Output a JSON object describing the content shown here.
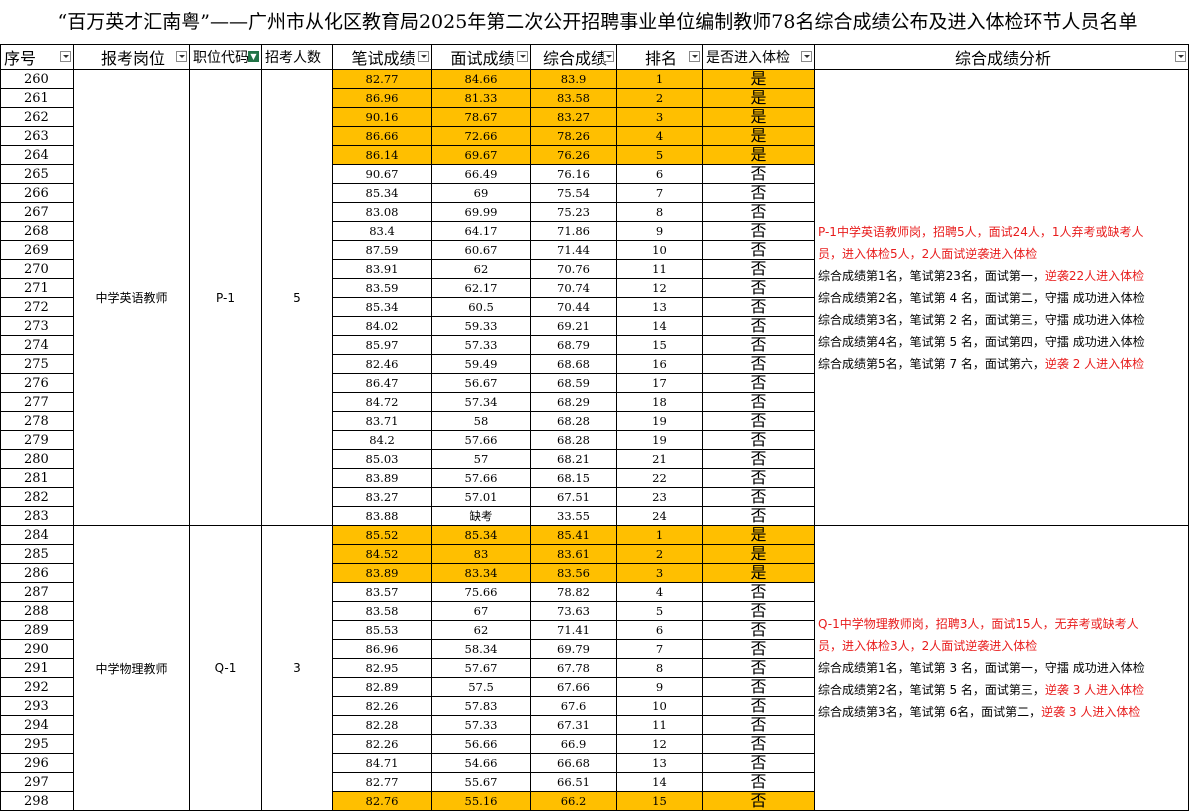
{
  "title": "“百万英才汇南粤”——广州市从化区教育局2025年第二次公开招聘事业单位编制教师78名综合成绩公布及进入体检环节人员名单",
  "headers": {
    "seq": "序号",
    "position": "报考岗位",
    "code": "职位代码",
    "quota": "招考人数",
    "written": "笔试成绩",
    "interview": "面试成绩",
    "total": "综合成绩",
    "rank": "排名",
    "exam": "是否进入体检",
    "analysis": "综合成绩分析"
  },
  "colors": {
    "highlight": "#ffbf00",
    "note_red": "#e81c1c"
  },
  "groups": [
    {
      "position": "中学英语教师",
      "code": "P-1",
      "quota": "5",
      "analysis": [
        [
          {
            "t": "P-1中学英语教师岗，招聘5人，面试24人，1人弃考或缺考人",
            "red": true
          }
        ],
        [
          {
            "t": "员，进入体检5人，2人面试逆袭进入体检",
            "red": true
          }
        ],
        [
          {
            "t": "综合成绩第1名，笔试第23名，面试第一，",
            "red": false
          },
          {
            "t": "逆袭22人进入体检",
            "red": true
          }
        ],
        [
          {
            "t": "综合成绩第2名，笔试第 4 名，面试第二，守擂 成功进入体检",
            "red": false
          }
        ],
        [
          {
            "t": "综合成绩第3名，笔试第 2 名，面试第三，守擂 成功进入体检",
            "red": false
          }
        ],
        [
          {
            "t": "综合成绩第4名，笔试第 5 名，面试第四，守擂 成功进入体检",
            "red": false
          }
        ],
        [
          {
            "t": "综合成绩第5名，笔试第 7 名，面试第六，",
            "red": false
          },
          {
            "t": "逆袭 2 人进入体检",
            "red": true
          }
        ]
      ],
      "rows": [
        {
          "seq": "260",
          "written": "82.77",
          "interview": "84.66",
          "total": "83.9",
          "rank": "1",
          "exam": "是",
          "hl": true
        },
        {
          "seq": "261",
          "written": "86.96",
          "interview": "81.33",
          "total": "83.58",
          "rank": "2",
          "exam": "是",
          "hl": true
        },
        {
          "seq": "262",
          "written": "90.16",
          "interview": "78.67",
          "total": "83.27",
          "rank": "3",
          "exam": "是",
          "hl": true
        },
        {
          "seq": "263",
          "written": "86.66",
          "interview": "72.66",
          "total": "78.26",
          "rank": "4",
          "exam": "是",
          "hl": true
        },
        {
          "seq": "264",
          "written": "86.14",
          "interview": "69.67",
          "total": "76.26",
          "rank": "5",
          "exam": "是",
          "hl": true
        },
        {
          "seq": "265",
          "written": "90.67",
          "interview": "66.49",
          "total": "76.16",
          "rank": "6",
          "exam": "否",
          "hl": false
        },
        {
          "seq": "266",
          "written": "85.34",
          "interview": "69",
          "total": "75.54",
          "rank": "7",
          "exam": "否",
          "hl": false
        },
        {
          "seq": "267",
          "written": "83.08",
          "interview": "69.99",
          "total": "75.23",
          "rank": "8",
          "exam": "否",
          "hl": false
        },
        {
          "seq": "268",
          "written": "83.4",
          "interview": "64.17",
          "total": "71.86",
          "rank": "9",
          "exam": "否",
          "hl": false
        },
        {
          "seq": "269",
          "written": "87.59",
          "interview": "60.67",
          "total": "71.44",
          "rank": "10",
          "exam": "否",
          "hl": false
        },
        {
          "seq": "270",
          "written": "83.91",
          "interview": "62",
          "total": "70.76",
          "rank": "11",
          "exam": "否",
          "hl": false
        },
        {
          "seq": "271",
          "written": "83.59",
          "interview": "62.17",
          "total": "70.74",
          "rank": "12",
          "exam": "否",
          "hl": false
        },
        {
          "seq": "272",
          "written": "85.34",
          "interview": "60.5",
          "total": "70.44",
          "rank": "13",
          "exam": "否",
          "hl": false
        },
        {
          "seq": "273",
          "written": "84.02",
          "interview": "59.33",
          "total": "69.21",
          "rank": "14",
          "exam": "否",
          "hl": false
        },
        {
          "seq": "274",
          "written": "85.97",
          "interview": "57.33",
          "total": "68.79",
          "rank": "15",
          "exam": "否",
          "hl": false
        },
        {
          "seq": "275",
          "written": "82.46",
          "interview": "59.49",
          "total": "68.68",
          "rank": "16",
          "exam": "否",
          "hl": false
        },
        {
          "seq": "276",
          "written": "86.47",
          "interview": "56.67",
          "total": "68.59",
          "rank": "17",
          "exam": "否",
          "hl": false
        },
        {
          "seq": "277",
          "written": "84.72",
          "interview": "57.34",
          "total": "68.29",
          "rank": "18",
          "exam": "否",
          "hl": false
        },
        {
          "seq": "278",
          "written": "83.71",
          "interview": "58",
          "total": "68.28",
          "rank": "19",
          "exam": "否",
          "hl": false
        },
        {
          "seq": "279",
          "written": "84.2",
          "interview": "57.66",
          "total": "68.28",
          "rank": "19",
          "exam": "否",
          "hl": false
        },
        {
          "seq": "280",
          "written": "85.03",
          "interview": "57",
          "total": "68.21",
          "rank": "21",
          "exam": "否",
          "hl": false
        },
        {
          "seq": "281",
          "written": "83.89",
          "interview": "57.66",
          "total": "68.15",
          "rank": "22",
          "exam": "否",
          "hl": false
        },
        {
          "seq": "282",
          "written": "83.27",
          "interview": "57.01",
          "total": "67.51",
          "rank": "23",
          "exam": "否",
          "hl": false
        },
        {
          "seq": "283",
          "written": "83.88",
          "interview": "缺考",
          "total": "33.55",
          "rank": "24",
          "exam": "否",
          "hl": false
        }
      ]
    },
    {
      "position": "中学物理教师",
      "code": "Q-1",
      "quota": "3",
      "analysis": [
        [
          {
            "t": "Q-1中学物理教师岗，招聘3人，面试15人，无弃考或缺考人",
            "red": true
          }
        ],
        [
          {
            "t": "员，进入体检3人，2人面试逆袭进入体检",
            "red": true
          }
        ],
        [
          {
            "t": "综合成绩第1名，笔试第 3 名，面试第一，守擂 成功进入体检",
            "red": false
          }
        ],
        [
          {
            "t": "综合成绩第2名，笔试第 5 名，面试第三，",
            "red": false
          },
          {
            "t": "逆袭 3 人进入体检",
            "red": true
          }
        ],
        [
          {
            "t": "综合成绩第3名，笔试第  6名，面试第二，",
            "red": false
          },
          {
            "t": "逆袭 3 人进入体检",
            "red": true
          }
        ]
      ],
      "rows": [
        {
          "seq": "284",
          "written": "85.52",
          "interview": "85.34",
          "total": "85.41",
          "rank": "1",
          "exam": "是",
          "hl": true
        },
        {
          "seq": "285",
          "written": "84.52",
          "interview": "83",
          "total": "83.61",
          "rank": "2",
          "exam": "是",
          "hl": true
        },
        {
          "seq": "286",
          "written": "83.89",
          "interview": "83.34",
          "total": "83.56",
          "rank": "3",
          "exam": "是",
          "hl": true
        },
        {
          "seq": "287",
          "written": "83.57",
          "interview": "75.66",
          "total": "78.82",
          "rank": "4",
          "exam": "否",
          "hl": false
        },
        {
          "seq": "288",
          "written": "83.58",
          "interview": "67",
          "total": "73.63",
          "rank": "5",
          "exam": "否",
          "hl": false
        },
        {
          "seq": "289",
          "written": "85.53",
          "interview": "62",
          "total": "71.41",
          "rank": "6",
          "exam": "否",
          "hl": false
        },
        {
          "seq": "290",
          "written": "86.96",
          "interview": "58.34",
          "total": "69.79",
          "rank": "7",
          "exam": "否",
          "hl": false
        },
        {
          "seq": "291",
          "written": "82.95",
          "interview": "57.67",
          "total": "67.78",
          "rank": "8",
          "exam": "否",
          "hl": false
        },
        {
          "seq": "292",
          "written": "82.89",
          "interview": "57.5",
          "total": "67.66",
          "rank": "9",
          "exam": "否",
          "hl": false
        },
        {
          "seq": "293",
          "written": "82.26",
          "interview": "57.83",
          "total": "67.6",
          "rank": "10",
          "exam": "否",
          "hl": false
        },
        {
          "seq": "294",
          "written": "82.28",
          "interview": "57.33",
          "total": "67.31",
          "rank": "11",
          "exam": "否",
          "hl": false
        },
        {
          "seq": "295",
          "written": "82.26",
          "interview": "56.66",
          "total": "66.9",
          "rank": "12",
          "exam": "否",
          "hl": false
        },
        {
          "seq": "296",
          "written": "84.71",
          "interview": "54.66",
          "total": "66.68",
          "rank": "13",
          "exam": "否",
          "hl": false
        },
        {
          "seq": "297",
          "written": "82.77",
          "interview": "55.67",
          "total": "66.51",
          "rank": "14",
          "exam": "否",
          "hl": false
        },
        {
          "seq": "298",
          "written": "82.76",
          "interview": "55.16",
          "total": "66.2",
          "rank": "15",
          "exam": "否",
          "hl": true
        }
      ]
    }
  ]
}
